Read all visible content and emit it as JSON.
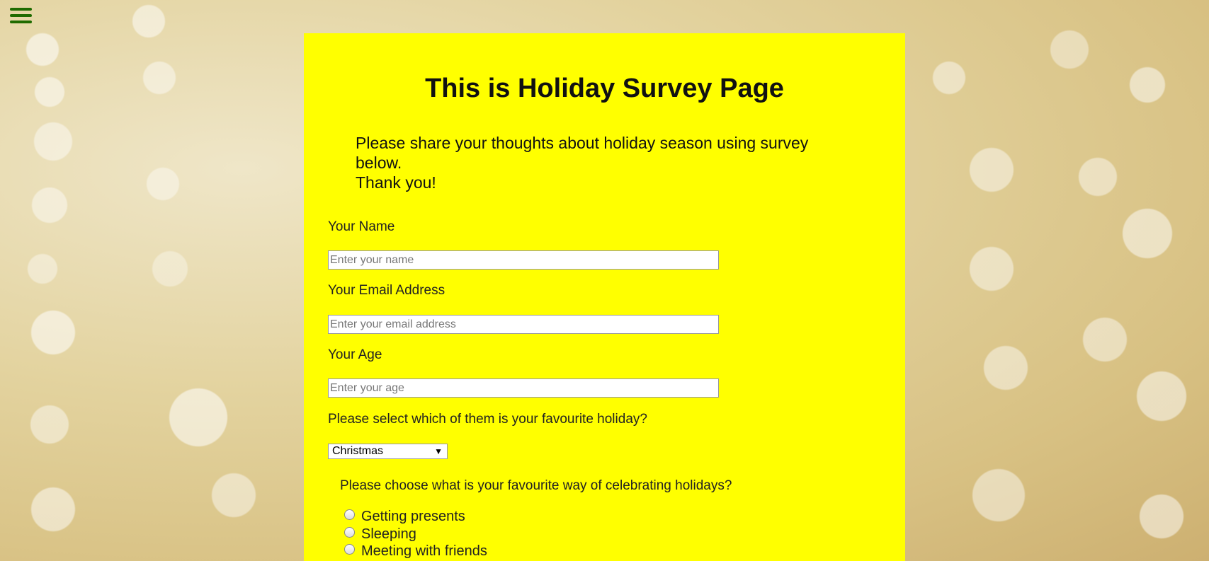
{
  "menu": {
    "icon": "hamburger-menu-icon"
  },
  "page": {
    "title": "This is Holiday Survey Page",
    "intro_line1": "Please share your thoughts about holiday season using survey below.",
    "intro_line2": "Thank you!"
  },
  "form": {
    "name": {
      "label": "Your Name",
      "placeholder": "Enter your name"
    },
    "email": {
      "label": "Your Email Address",
      "placeholder": "Enter your email address"
    },
    "age": {
      "label": "Your Age",
      "placeholder": "Enter your age"
    },
    "holiday": {
      "label": "Please select which of them is your favourite holiday?",
      "selected": "Christmas"
    },
    "celebrate": {
      "label": "Please choose what is your favourite way of celebrating holidays?",
      "options": [
        "Getting presents",
        "Sleeping",
        "Meeting with friends"
      ]
    }
  },
  "colors": {
    "panel_background": "#ffff00",
    "menu_icon": "#1f6b00"
  }
}
